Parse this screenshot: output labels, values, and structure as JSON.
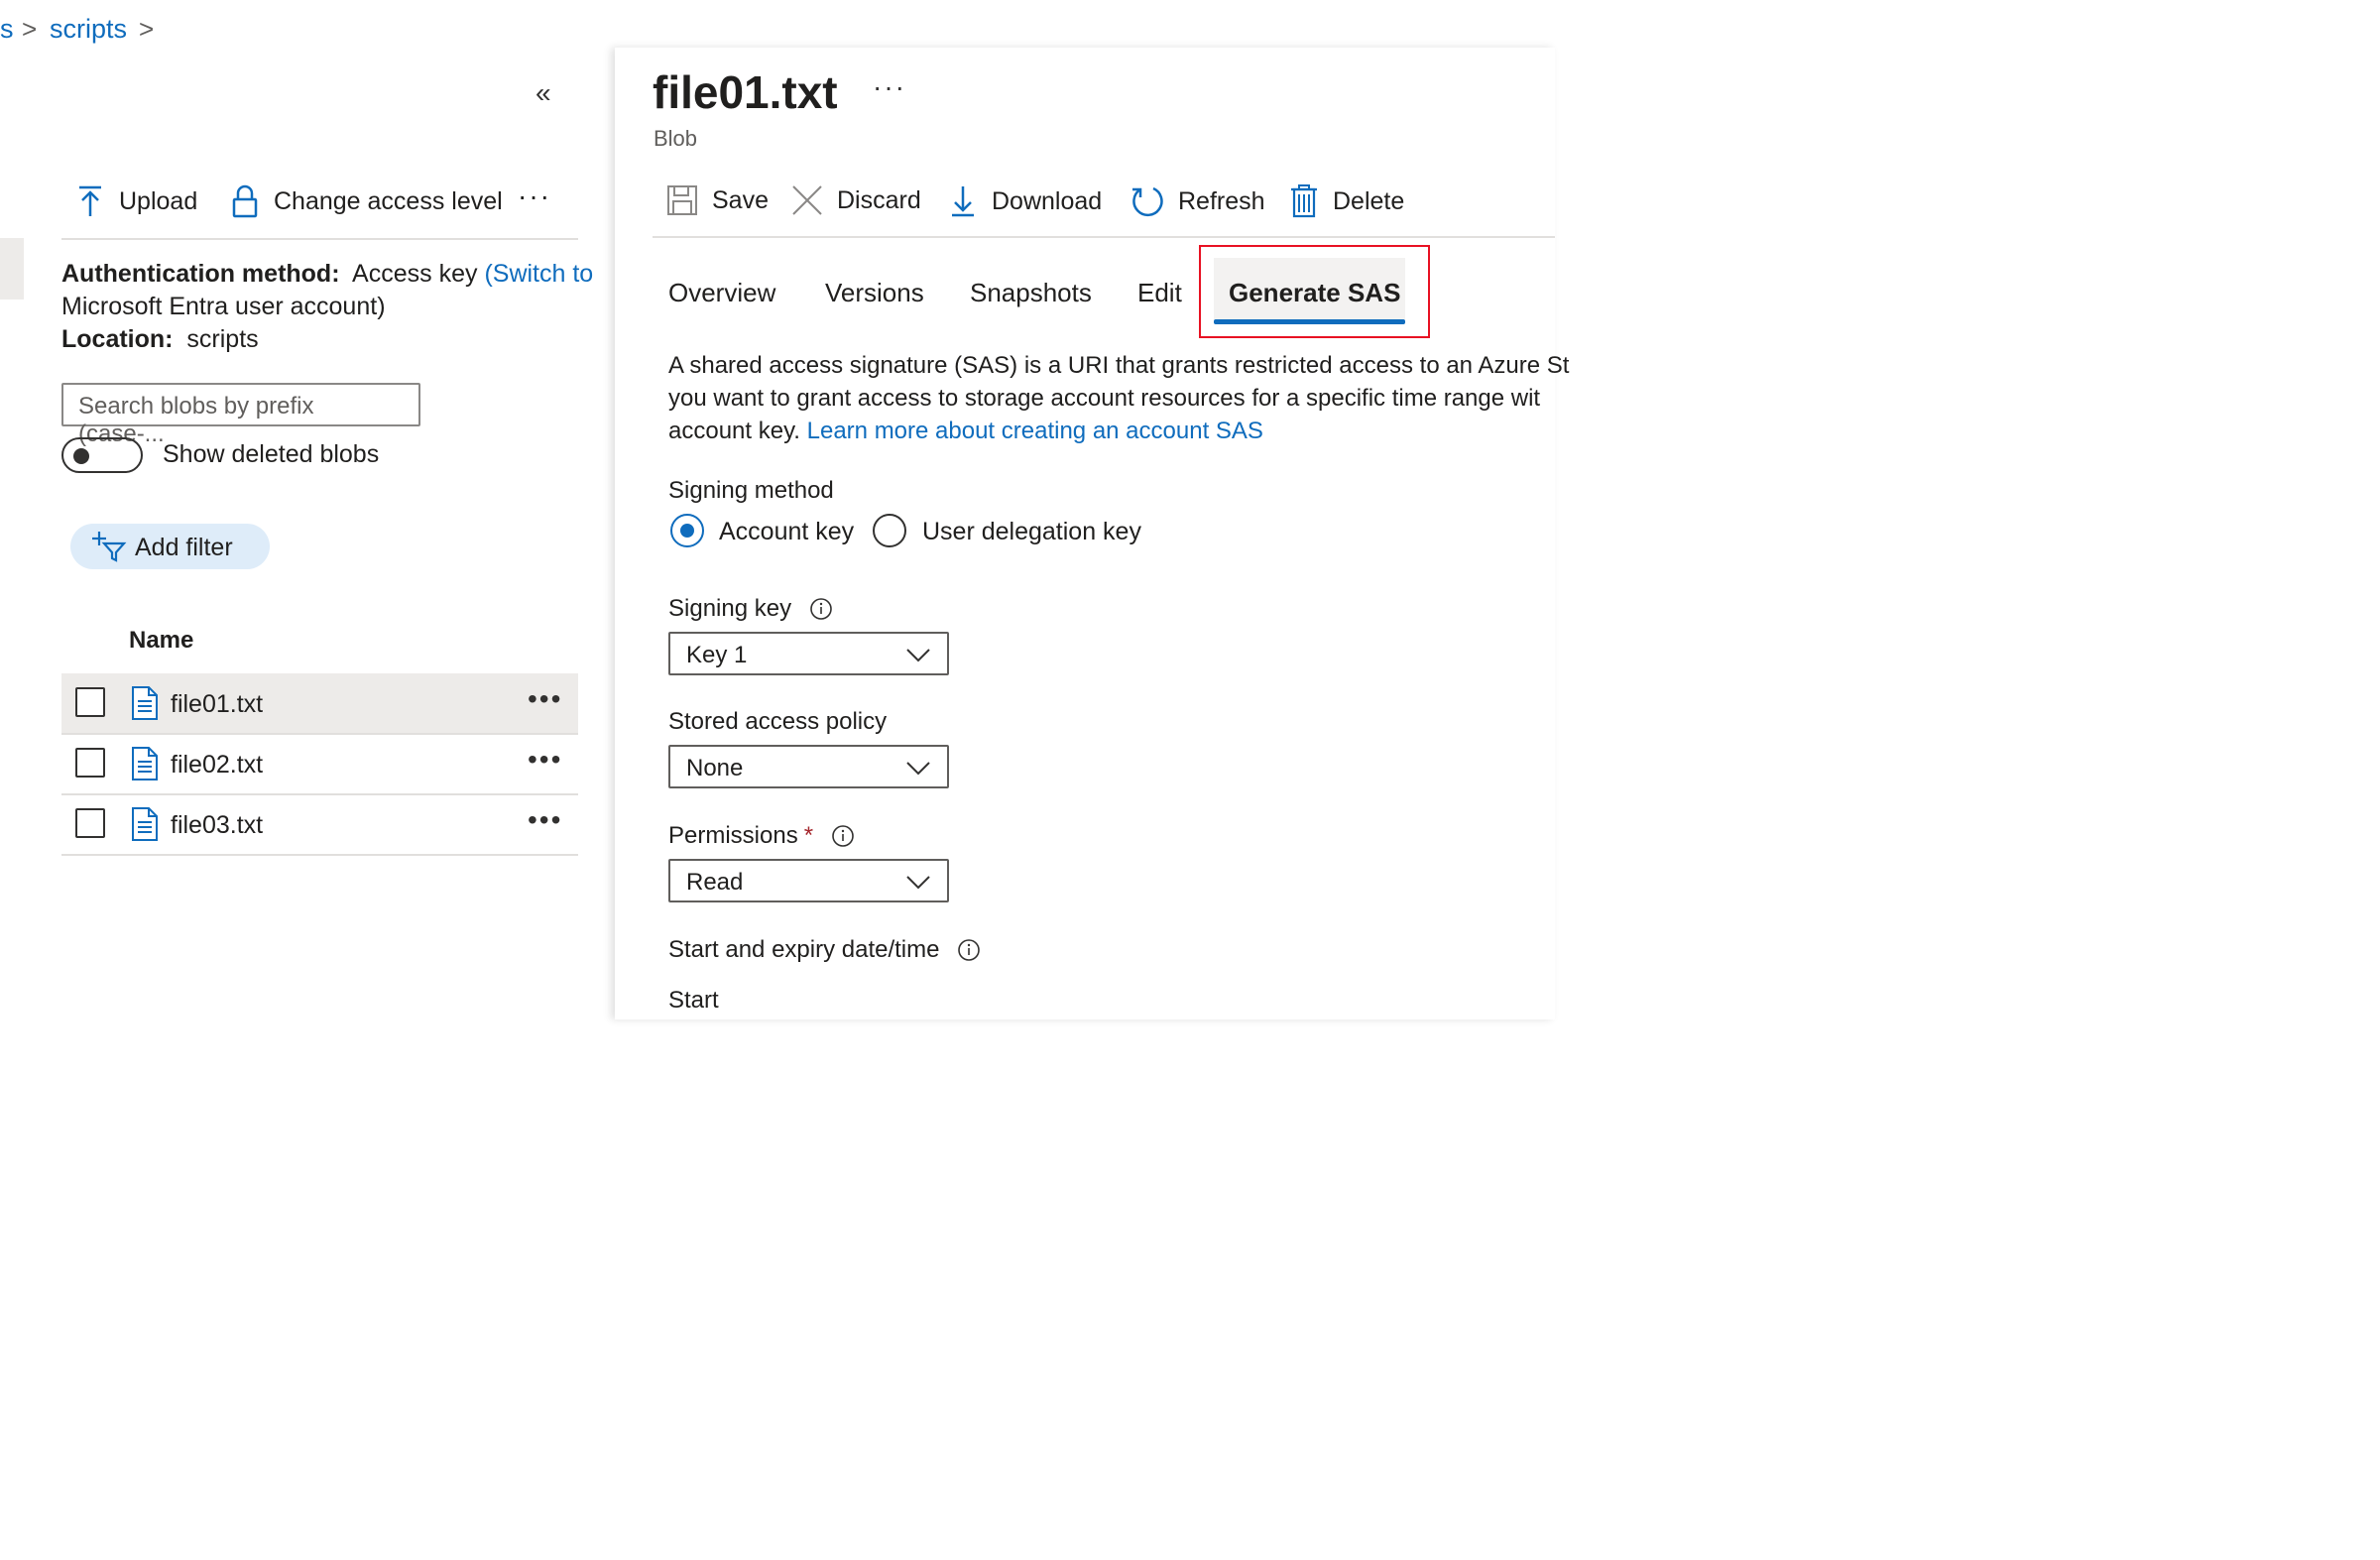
{
  "breadcrumb": {
    "prev_fragment": "s",
    "current": "scripts",
    "separator": ">"
  },
  "left_toolbar": {
    "upload_label": "Upload",
    "change_access_label": "Change access level",
    "more_label": "···"
  },
  "container_info": {
    "auth_label": "Authentication method:",
    "auth_value": "Access key",
    "auth_switch_part1": "(Switch to",
    "auth_switch_part2": "Microsoft Entra user account)",
    "location_label": "Location:",
    "location_value": "scripts"
  },
  "search": {
    "placeholder": "Search blobs by prefix (case-..."
  },
  "show_deleted": {
    "label": "Show deleted blobs",
    "on": false
  },
  "add_filter": {
    "label": "Add filter"
  },
  "blob_list": {
    "column_header": "Name",
    "rows": [
      {
        "name": "file01.txt",
        "more": "•••"
      },
      {
        "name": "file02.txt",
        "more": "•••"
      },
      {
        "name": "file03.txt",
        "more": "•••"
      }
    ]
  },
  "detail": {
    "title": "file01.txt",
    "title_more": "···",
    "subtitle": "Blob",
    "toolbar": {
      "save": "Save",
      "discard": "Discard",
      "download": "Download",
      "refresh": "Refresh",
      "delete": "Delete"
    },
    "tabs": [
      "Overview",
      "Versions",
      "Snapshots",
      "Edit",
      "Generate SAS"
    ],
    "active_tab": "Generate SAS",
    "description": {
      "line1": "A shared access signature (SAS) is a URI that grants restricted access to an Azure St",
      "line2": "you want to grant access to storage account resources for a specific time range wit",
      "line3_text": "account key.",
      "line3_link": "Learn more about creating an account SAS"
    },
    "signing_method": {
      "label": "Signing method",
      "options": [
        "Account key",
        "User delegation key"
      ],
      "selected": "Account key"
    },
    "signing_key": {
      "label": "Signing key",
      "value": "Key 1"
    },
    "stored_access_policy": {
      "label": "Stored access policy",
      "value": "None"
    },
    "permissions": {
      "label": "Permissions",
      "required_mark": "*",
      "value": "Read"
    },
    "start_expiry": {
      "label": "Start and expiry date/time"
    },
    "start": {
      "label": "Start"
    }
  },
  "colors": {
    "accent": "#0f6cbd",
    "highlight_box": "#e81123",
    "selected_row": "#edebe9",
    "filter_pill": "#deecf9"
  }
}
